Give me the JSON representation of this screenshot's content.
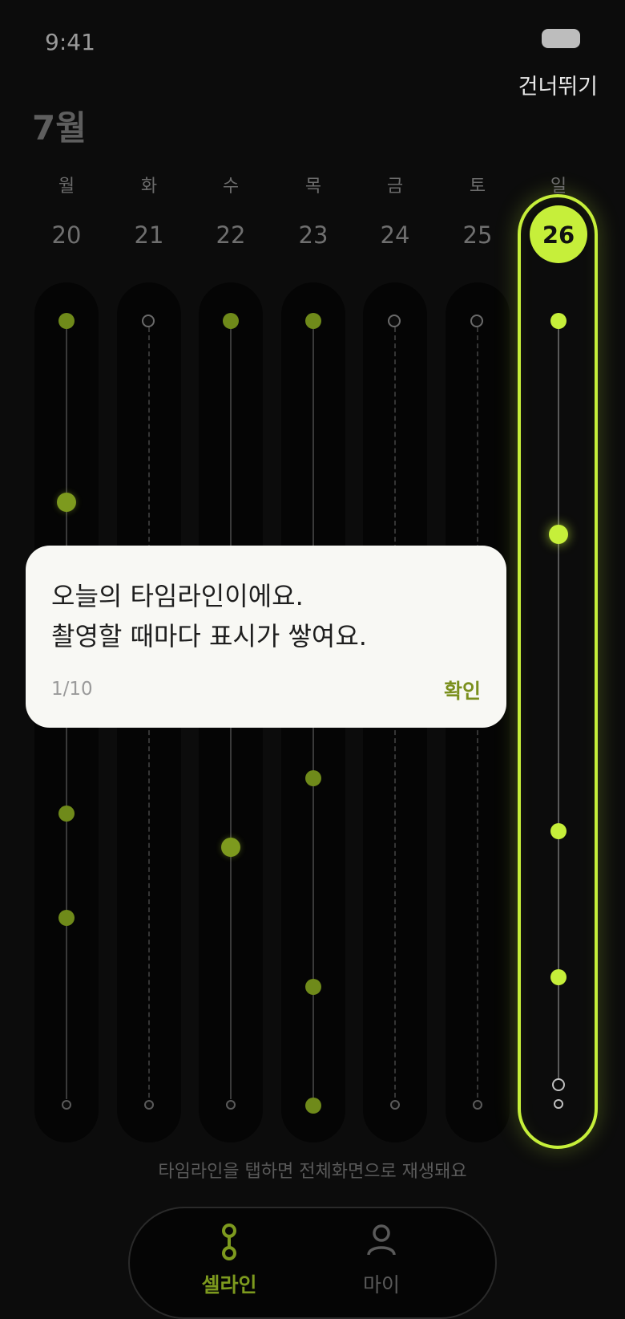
{
  "status": {
    "time": "9:41"
  },
  "header": {
    "skip_label": "건너뛰기",
    "month": "7월"
  },
  "week": {
    "days": [
      {
        "dow": "월",
        "date": "20"
      },
      {
        "dow": "화",
        "date": "21"
      },
      {
        "dow": "수",
        "date": "22"
      },
      {
        "dow": "목",
        "date": "23"
      },
      {
        "dow": "금",
        "date": "24"
      },
      {
        "dow": "토",
        "date": "25"
      },
      {
        "dow": "일",
        "date": "26"
      }
    ],
    "active_index": 6
  },
  "colors": {
    "accent": "#c6ef3a",
    "accent_dim": "#7d9a1e",
    "background": "#0c0c0c",
    "tooltip_bg": "#f8f8f4"
  },
  "tooltip": {
    "line1": "오늘의 타임라인이에요.",
    "line2": "촬영할 때마다 표시가 쌓여요.",
    "step": "1/10",
    "confirm_label": "확인"
  },
  "hint": "타임라인을 탭하면 전체화면으로 재생돼요",
  "nav": {
    "items": [
      {
        "label": "셀라인",
        "icon": "timeline-icon",
        "active": true
      },
      {
        "label": "마이",
        "icon": "person-icon",
        "active": false
      }
    ]
  }
}
